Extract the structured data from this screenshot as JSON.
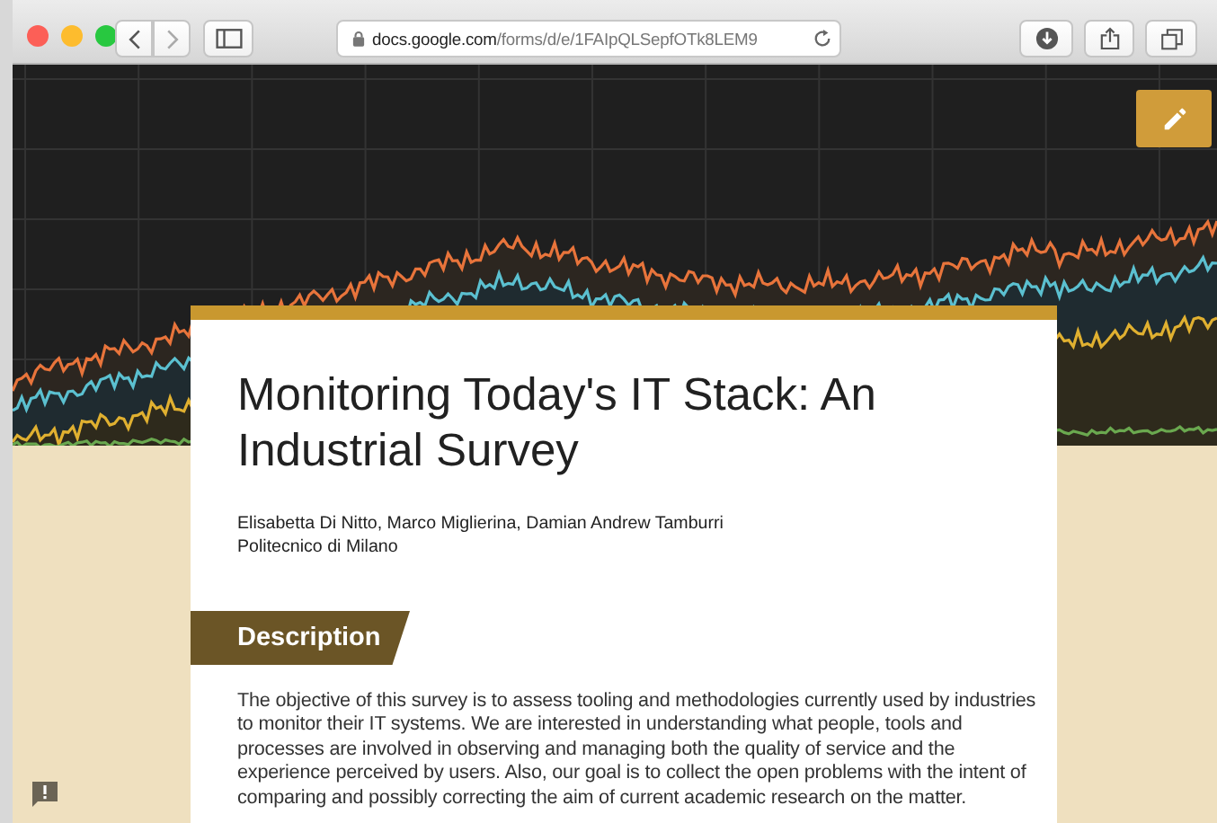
{
  "browser": {
    "url_host": "docs.google.com",
    "url_path": "/forms/d/e/1FAIpQLSepfOTk8LEM9"
  },
  "form": {
    "title": "Monitoring Today's IT Stack: An Industrial Survey",
    "authors": "Elisabetta Di Nitto, Marco Miglierina, Damian Andrew Tamburri",
    "affiliation": "Politecnico di Milano",
    "section_title": "Description",
    "description": "The objective of this survey is to assess tooling and methodologies currently used by industries to monitor their IT systems. We are interested in understanding what people, tools and processes are involved in observing and managing  both the quality of service and the experience perceived by users. Also, our goal is to collect the open problems with the intent of comparing and possibly correcting the aim of current academic research on the matter."
  }
}
